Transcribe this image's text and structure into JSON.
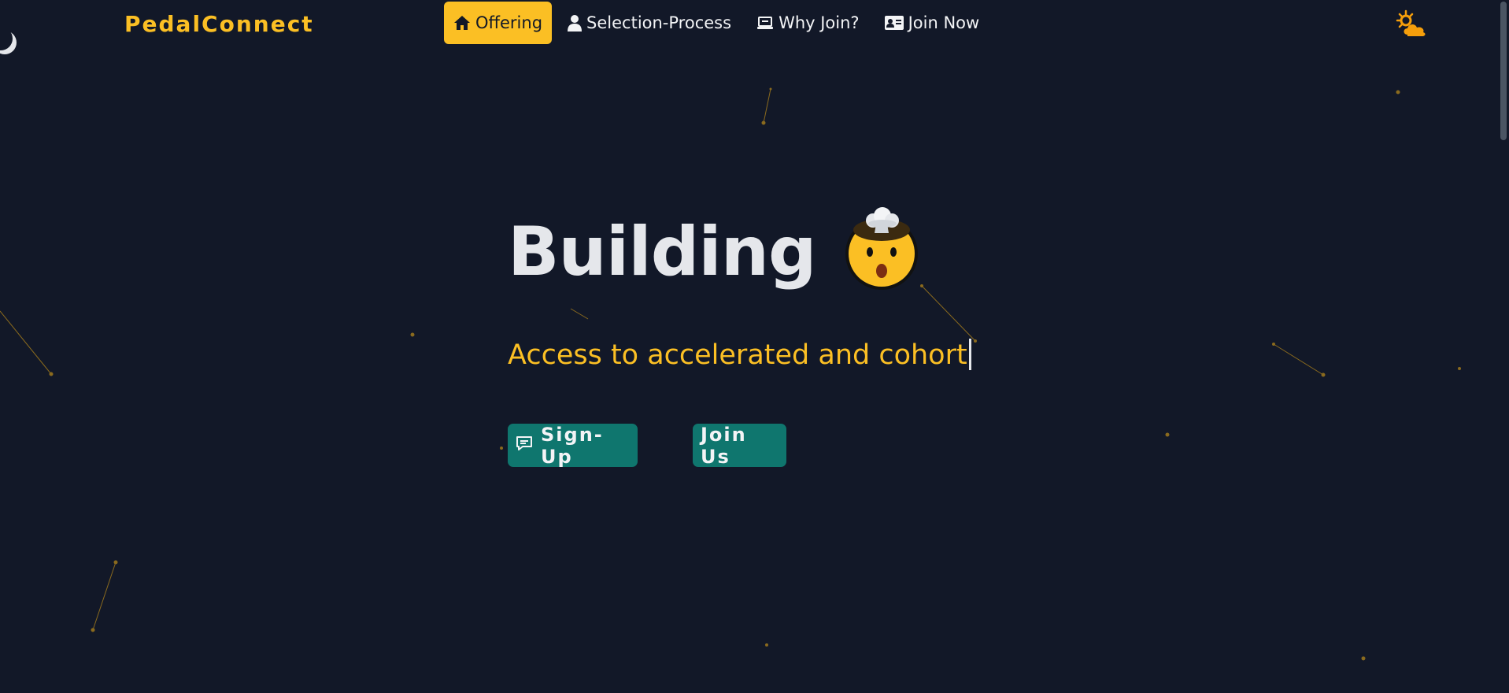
{
  "brand": {
    "name": "PedalConnect"
  },
  "nav": {
    "items": [
      {
        "label": "Offering",
        "icon": "home-icon",
        "active": true
      },
      {
        "label": "Selection-Process",
        "icon": "user-icon",
        "active": false
      },
      {
        "label": "Why Join?",
        "icon": "laptop-icon",
        "active": false
      },
      {
        "label": "Join Now",
        "icon": "id-card-icon",
        "active": false
      }
    ],
    "theme_toggle_icon": "sun-cloud-icon"
  },
  "hero": {
    "title": "Building",
    "emoji_icon": "exploding-head-icon",
    "subtitle": "Access to accelerated and cohort"
  },
  "buttons": {
    "signup_label": "Sign-Up",
    "signup_icon": "chat-icon",
    "join_label": "Join Us"
  },
  "colors": {
    "background": "#121828",
    "accent": "#fbbf24",
    "button": "#0f766e",
    "text": "#e5e7eb"
  }
}
